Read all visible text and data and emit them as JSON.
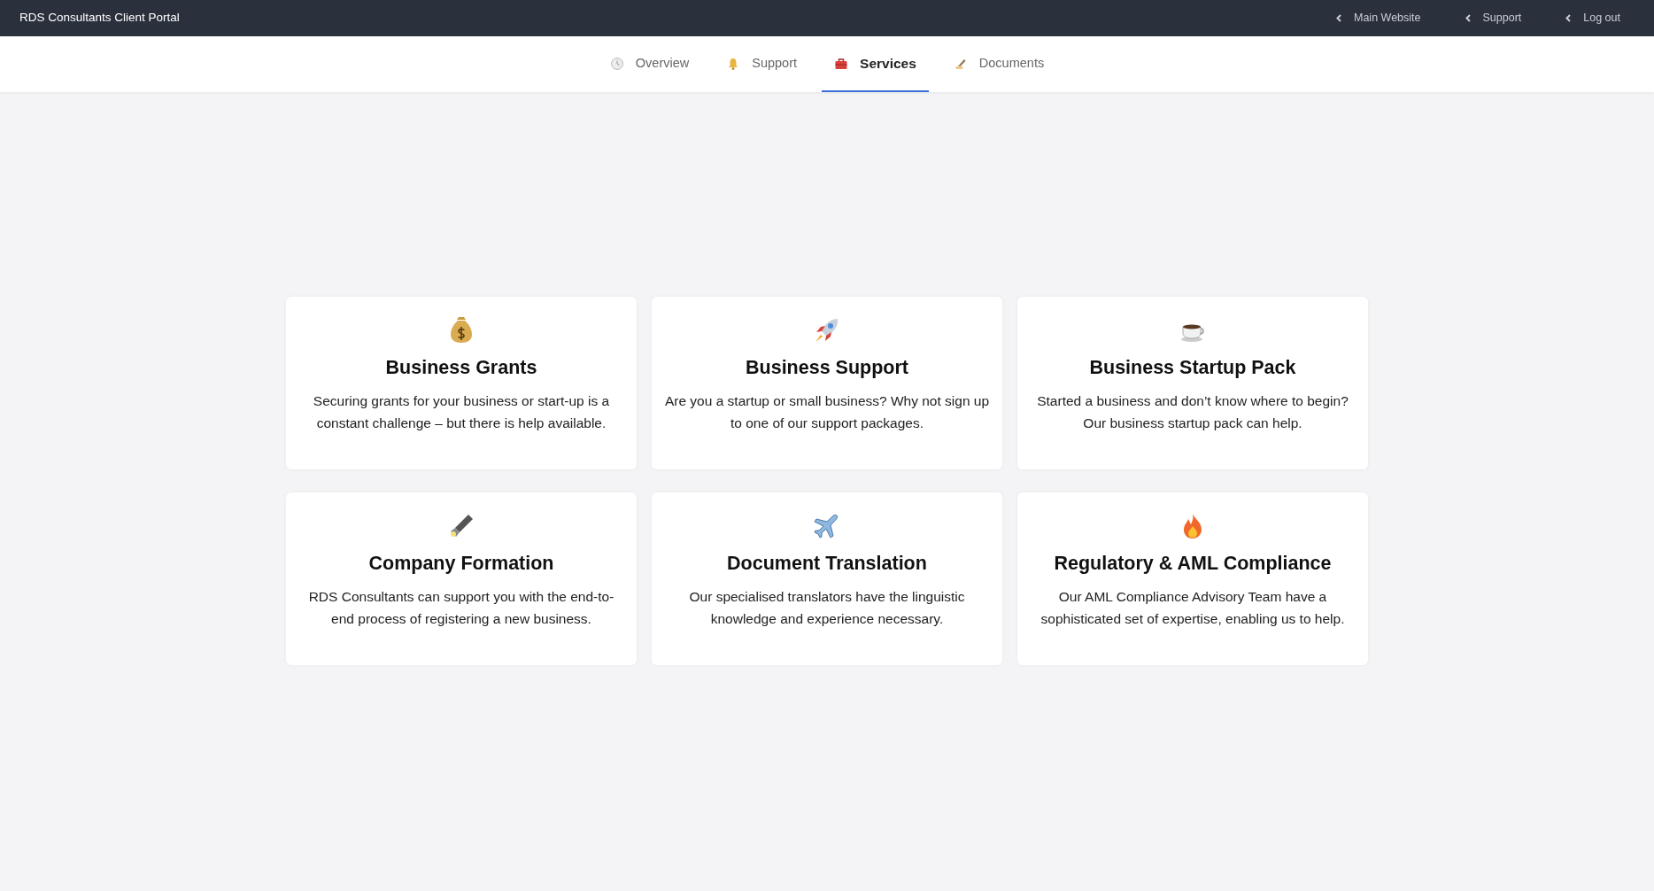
{
  "header": {
    "title": "RDS Consultants Client Portal",
    "links": [
      {
        "label": "Main Website"
      },
      {
        "label": "Support"
      },
      {
        "label": "Log out"
      }
    ]
  },
  "tabs": [
    {
      "label": "Overview",
      "selected": false
    },
    {
      "label": "Support",
      "selected": false
    },
    {
      "label": "Services",
      "selected": true
    },
    {
      "label": "Documents",
      "selected": false
    }
  ],
  "services": [
    {
      "title": "Business Grants",
      "description": "Securing grants for your business or start-up is a constant challenge – but there is help available."
    },
    {
      "title": "Business Support",
      "description": "Are you a startup or small business? Why not sign up to one of our support packages."
    },
    {
      "title": "Business Startup Pack",
      "description": "Started a business and don’t know where to begin? Our business startup pack can help."
    },
    {
      "title": "Company Formation",
      "description": "RDS Consultants can support you with the end-to-end process of registering a new business."
    },
    {
      "title": "Document Translation",
      "description": "Our specialised translators have the linguistic knowledge and experience necessary."
    },
    {
      "title": "Regulatory & AML Compliance",
      "description": "Our AML Compliance Advisory Team have a sophisticated set of expertise, enabling us to help."
    }
  ]
}
